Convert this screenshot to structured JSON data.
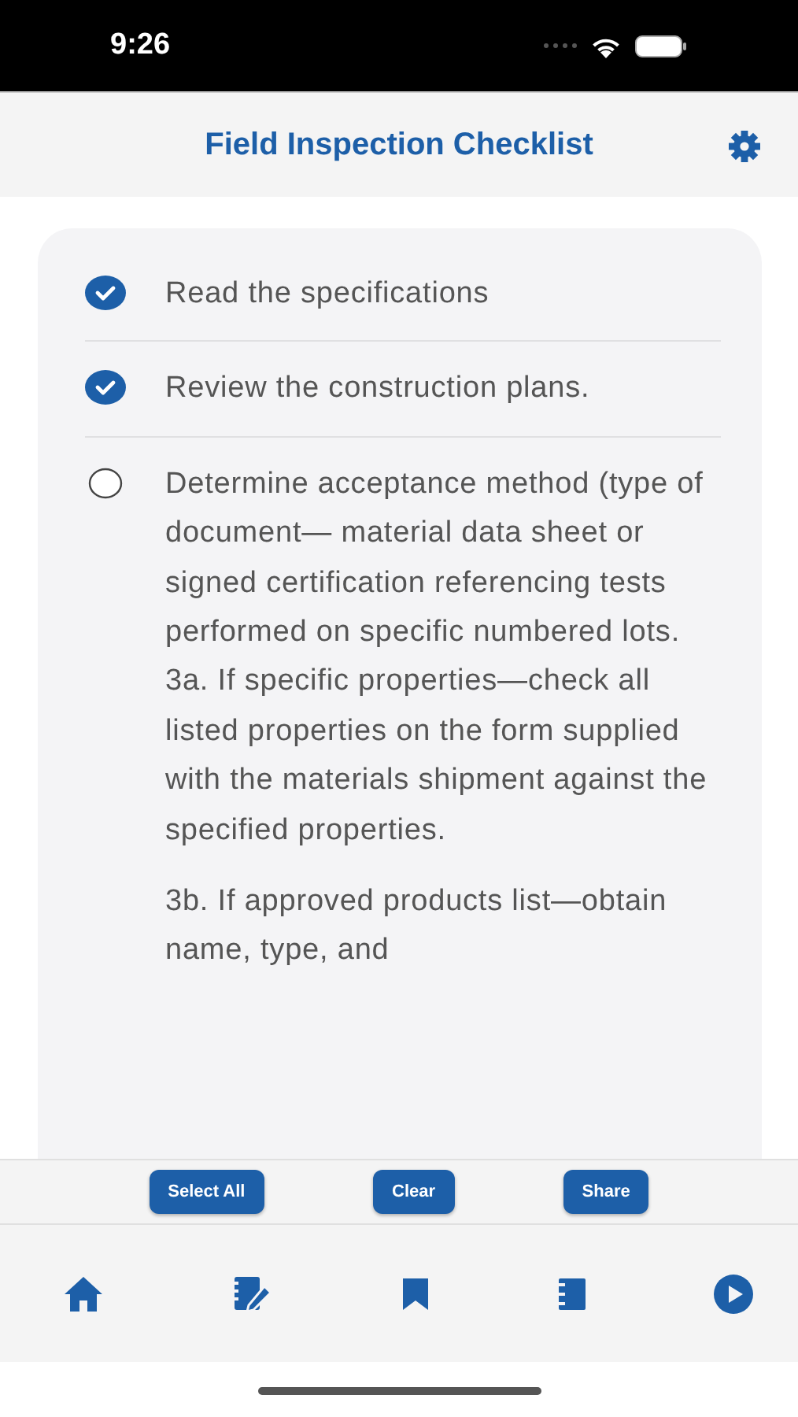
{
  "status_bar": {
    "time": "9:26"
  },
  "header": {
    "title": "Field Inspection Checklist"
  },
  "checklist": [
    {
      "checked": true,
      "paragraphs": [
        "Read the specifications"
      ]
    },
    {
      "checked": true,
      "paragraphs": [
        "Review the construction plans."
      ]
    },
    {
      "checked": false,
      "paragraphs": [
        "Determine acceptance method (type of document— material data sheet or signed certification referencing tests performed on specific numbered lots.\n3a. If specific properties—check all listed properties on the form supplied with the materials shipment against the specified properties.",
        "3b. If approved products list—obtain name, type, and"
      ]
    }
  ],
  "actions": [
    "Select All",
    "Clear",
    "Share"
  ],
  "tab_bar": [
    {
      "kind": "home"
    },
    {
      "kind": "edit"
    },
    {
      "kind": "bookmark"
    },
    {
      "kind": "notebook"
    },
    {
      "kind": "play"
    }
  ]
}
